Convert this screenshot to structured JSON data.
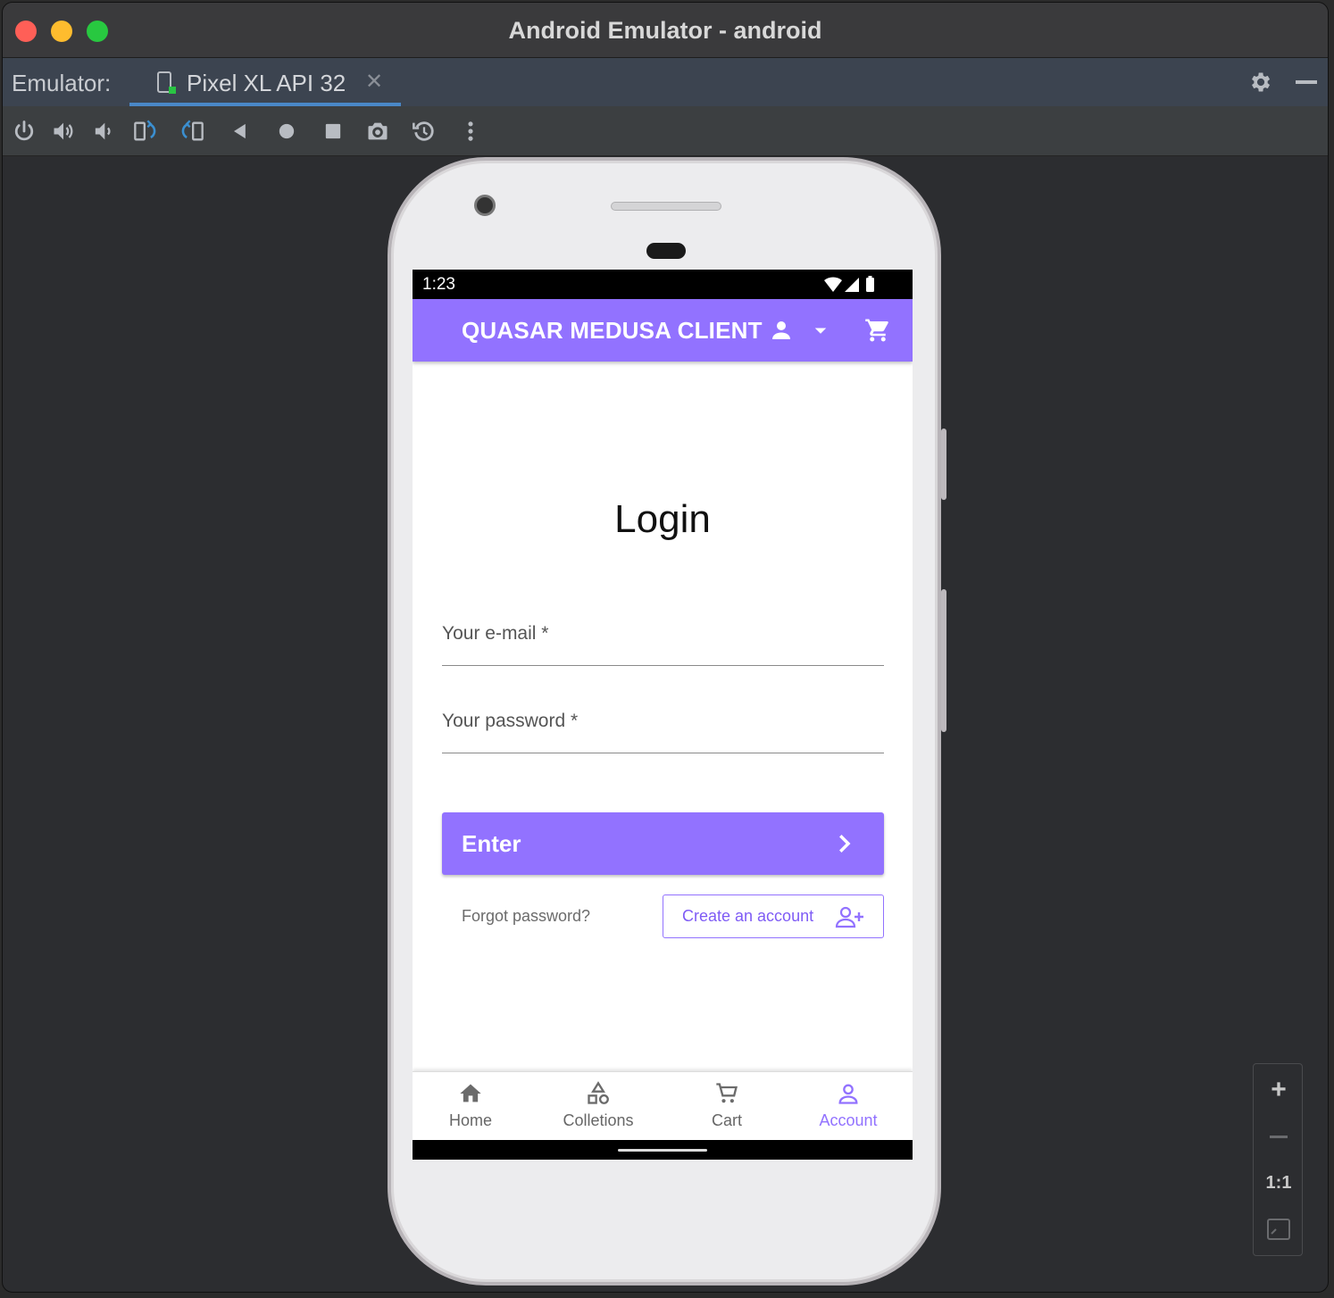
{
  "window": {
    "title": "Android Emulator - android"
  },
  "tabbar": {
    "prefix": "Emulator:",
    "tab_label": "Pixel XL API 32",
    "close_glyph": "✕"
  },
  "status": {
    "time": "1:23"
  },
  "app": {
    "title": "QUASAR MEDUSA CLIENT",
    "colors": {
      "primary": "#9272ff",
      "accent_text": "#7e5bf5"
    },
    "icons": [
      "account-icon",
      "dropdown-arrow-icon",
      "cart-icon"
    ]
  },
  "login": {
    "title": "Login",
    "email_label": "Your e-mail *",
    "password_label": "Your password *",
    "enter_label": "Enter",
    "forgot_label": "Forgot password?",
    "create_label": "Create an account"
  },
  "bottom_nav": {
    "items": [
      {
        "label": "Home",
        "icon": "home-icon"
      },
      {
        "label": "Colletions",
        "icon": "shapes-icon"
      },
      {
        "label": "Cart",
        "icon": "cart-icon"
      },
      {
        "label": "Account",
        "icon": "account-icon",
        "active": true
      }
    ]
  },
  "zoom": {
    "plus": "+",
    "one_to_one": "1:1"
  }
}
